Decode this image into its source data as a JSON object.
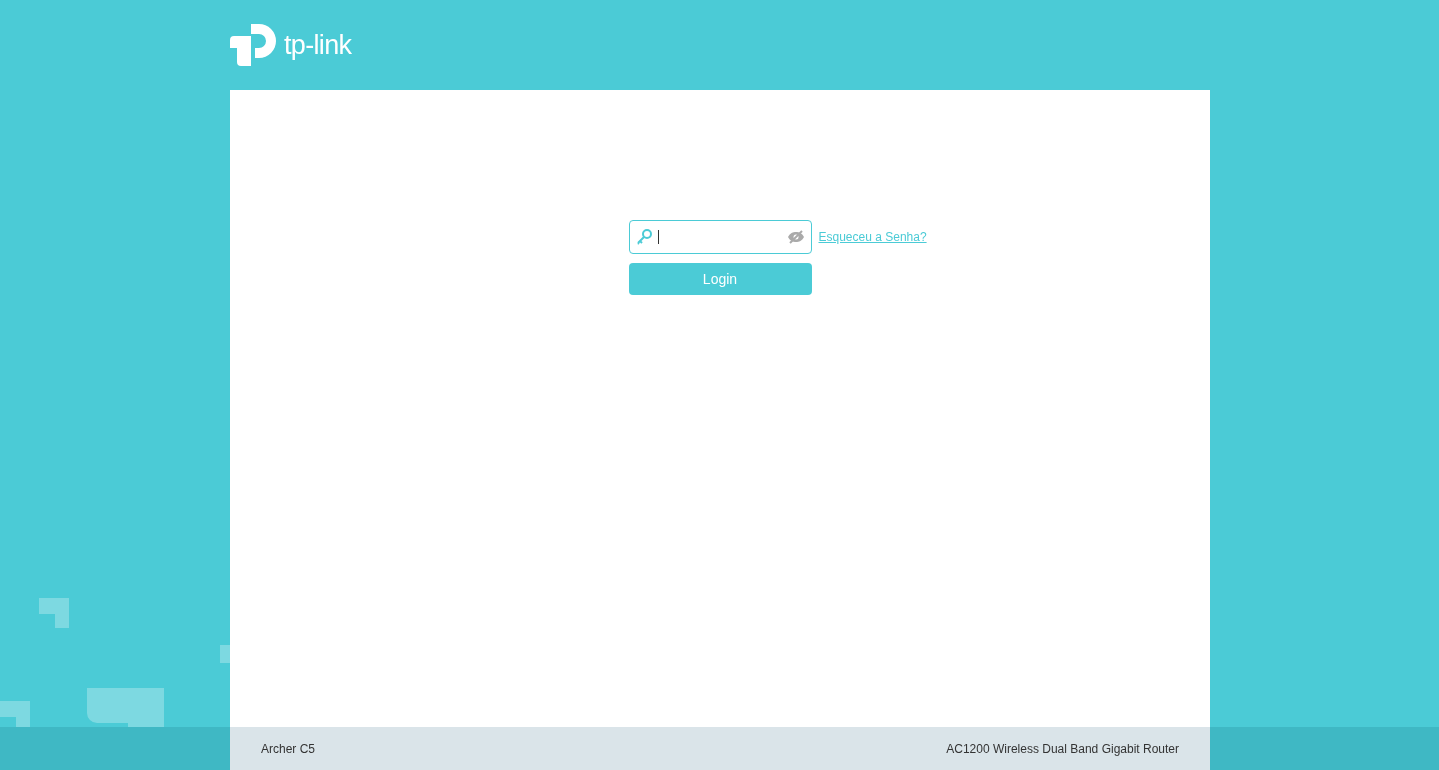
{
  "header": {
    "logo_text": "tp-link"
  },
  "login": {
    "forgot_link": "Esqueceu a Senha?",
    "button": "Login"
  },
  "footer": {
    "model": "Archer C5",
    "description": "AC1200 Wireless Dual Band Gigabit Router"
  }
}
